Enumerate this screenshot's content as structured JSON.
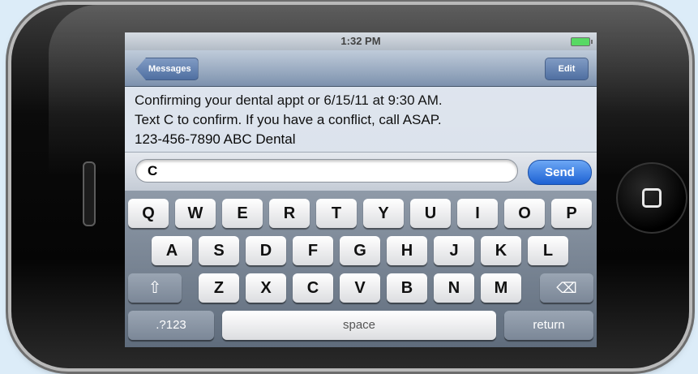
{
  "status": {
    "time": "1:32 PM"
  },
  "nav": {
    "back_label": "Messages",
    "edit_label": "Edit"
  },
  "message": {
    "lines": [
      "Confirming your dental appt or 6/15/11 at 9:30 AM.",
      "Text C to confirm. If you have a conflict, call ASAP.",
      "123-456-7890 ABC Dental"
    ]
  },
  "compose": {
    "value": "C",
    "send_label": "Send"
  },
  "keyboard": {
    "row1": [
      "Q",
      "W",
      "E",
      "R",
      "T",
      "Y",
      "U",
      "I",
      "O",
      "P"
    ],
    "row2": [
      "A",
      "S",
      "D",
      "F",
      "G",
      "H",
      "J",
      "K",
      "L"
    ],
    "row3": [
      "Z",
      "X",
      "C",
      "V",
      "B",
      "N",
      "M"
    ],
    "numbers_label": ".?123",
    "space_label": "space",
    "return_label": "return"
  },
  "colors": {
    "send": "#2f74e0",
    "nav": "#6f86a5",
    "keyboard": "#6f7b8b"
  }
}
